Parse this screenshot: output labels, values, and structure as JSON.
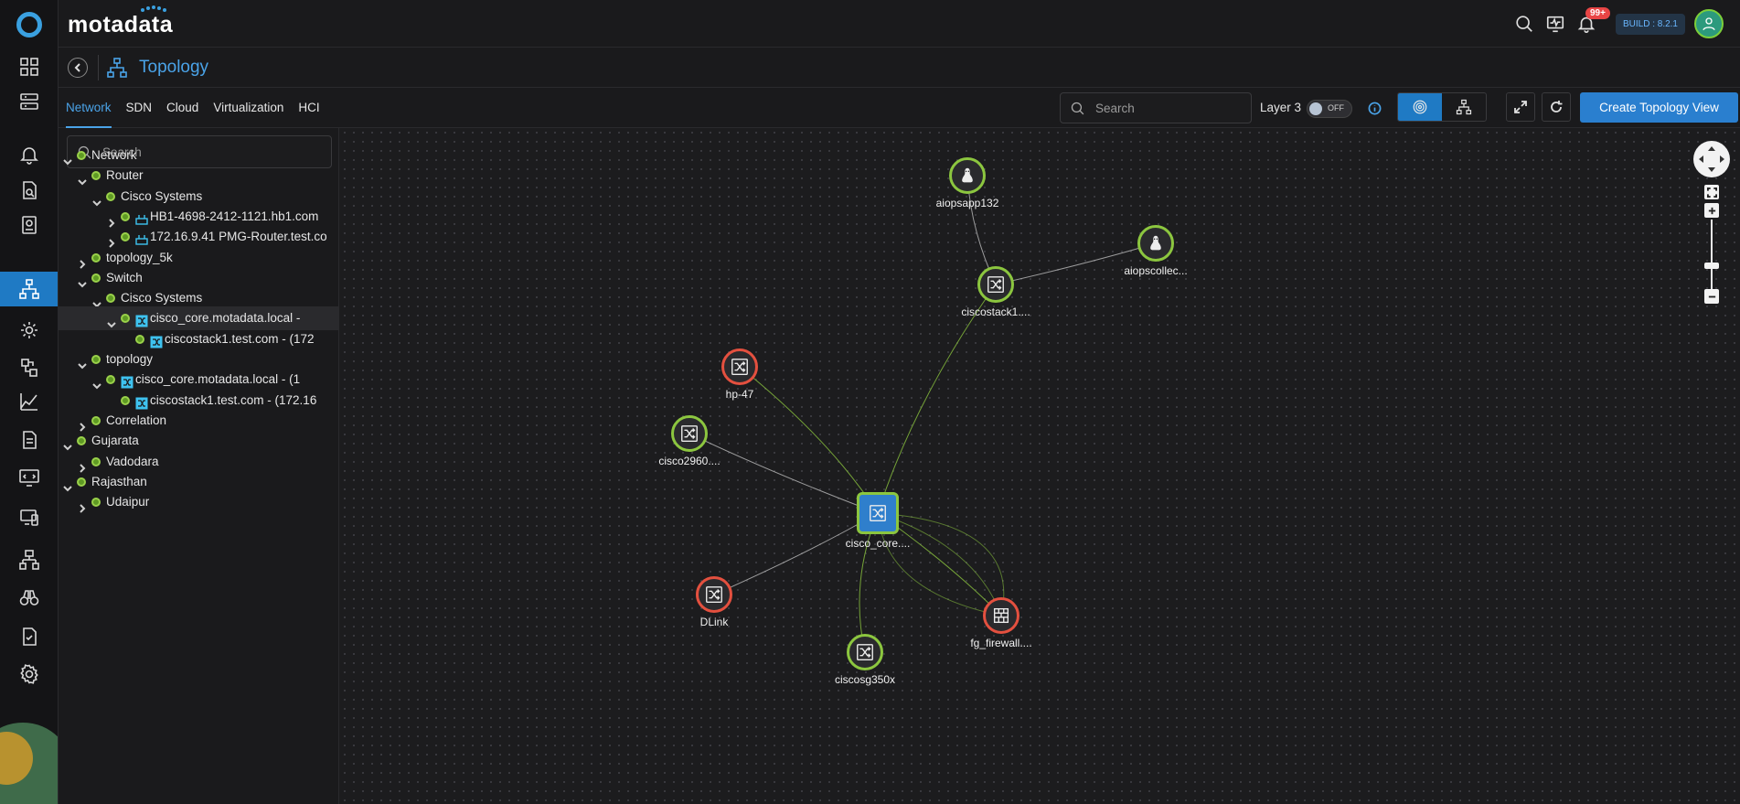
{
  "brand": {
    "name": "motadata"
  },
  "header": {
    "notification_count": "99+",
    "build": "BUILD : 8.2.1",
    "icons": [
      "search-icon",
      "monitor-icon",
      "bell-icon",
      "user-icon"
    ]
  },
  "rail": {
    "items": [
      "dashboard-icon",
      "server-icon",
      "alert-icon",
      "policy-icon",
      "inventory-icon",
      "topology-icon",
      "settings-cog-icon",
      "flow-icon",
      "metric-explorer-icon",
      "report-icon",
      "terminal-icon",
      "device-icon",
      "network-icon",
      "binoculars-icon",
      "audit-icon",
      "gear-icon"
    ],
    "active": "topology-icon"
  },
  "page": {
    "title": "Topology"
  },
  "tabs": [
    {
      "label": "Network",
      "active": true
    },
    {
      "label": "SDN",
      "active": false
    },
    {
      "label": "Cloud",
      "active": false
    },
    {
      "label": "Virtualization",
      "active": false
    },
    {
      "label": "HCI",
      "active": false
    }
  ],
  "toolbar": {
    "search_placeholder": "Search",
    "layer_label": "Layer 3",
    "layer_toggle": "OFF",
    "create_button": "Create Topology View"
  },
  "tree": {
    "search_placeholder": "Search",
    "rows": [
      {
        "label": "Network",
        "level": 0,
        "expanded": true,
        "icon": "none"
      },
      {
        "label": "Router",
        "level": 1,
        "expanded": true,
        "icon": "none"
      },
      {
        "label": "Cisco Systems",
        "level": 2,
        "expanded": true,
        "icon": "none"
      },
      {
        "label": "HB1-4698-2412-1121.hb1.com",
        "level": 3,
        "expanded": false,
        "icon": "router"
      },
      {
        "label": "172.16.9.41 PMG-Router.test.co",
        "level": 3,
        "expanded": false,
        "icon": "router"
      },
      {
        "label": "topology_5k",
        "level": 1,
        "expanded": false,
        "icon": "none"
      },
      {
        "label": "Switch",
        "level": 1,
        "expanded": true,
        "icon": "none"
      },
      {
        "label": "Cisco Systems",
        "level": 2,
        "expanded": true,
        "icon": "none"
      },
      {
        "label": "cisco_core.motadata.local -",
        "level": 3,
        "expanded": true,
        "icon": "switch",
        "selected": true
      },
      {
        "label": "ciscostack1.test.com - (172",
        "level": 4,
        "expanded": null,
        "icon": "switch"
      },
      {
        "label": "topology",
        "level": 1,
        "expanded": true,
        "icon": "none"
      },
      {
        "label": "cisco_core.motadata.local - (1",
        "level": 2,
        "expanded": true,
        "icon": "switch"
      },
      {
        "label": "ciscostack1.test.com - (172.16",
        "level": 3,
        "expanded": null,
        "icon": "switch"
      },
      {
        "label": "Correlation",
        "level": 1,
        "expanded": false,
        "icon": "none"
      },
      {
        "label": "Gujarata",
        "level": 0,
        "expanded": true,
        "icon": "none"
      },
      {
        "label": "Vadodara",
        "level": 1,
        "expanded": false,
        "icon": "none"
      },
      {
        "label": "Rajasthan",
        "level": 0,
        "expanded": true,
        "icon": "none"
      },
      {
        "label": "Udaipur",
        "level": 1,
        "expanded": false,
        "icon": "none"
      }
    ]
  },
  "topology": {
    "nodes": [
      {
        "id": "aiopsapp132",
        "label": "aiopsapp132",
        "type": "linux",
        "status": "green"
      },
      {
        "id": "aiopscollec",
        "label": "aiopscollec...",
        "type": "linux",
        "status": "green"
      },
      {
        "id": "ciscostack1",
        "label": "ciscostack1....",
        "type": "switch",
        "status": "green"
      },
      {
        "id": "hp47",
        "label": "hp-47",
        "type": "switch",
        "status": "red"
      },
      {
        "id": "cisco2960",
        "label": "cisco2960....",
        "type": "switch",
        "status": "green"
      },
      {
        "id": "cisco_core",
        "label": "cisco_core....",
        "type": "switch",
        "status": "core"
      },
      {
        "id": "dlink",
        "label": "DLink",
        "type": "switch",
        "status": "red"
      },
      {
        "id": "fg_firewall",
        "label": "fg_firewall....",
        "type": "firewall",
        "status": "red"
      },
      {
        "id": "ciscosg350x",
        "label": "ciscosg350x",
        "type": "switch",
        "status": "green"
      }
    ],
    "links": [
      {
        "from": "aiopsapp132",
        "to": "ciscostack1",
        "color": "#bdbdbd"
      },
      {
        "from": "aiopscollec",
        "to": "ciscostack1",
        "color": "#bdbdbd"
      },
      {
        "from": "ciscostack1",
        "to": "cisco_core",
        "color": "#8cc63f"
      },
      {
        "from": "hp47",
        "to": "cisco_core",
        "color": "#8cc63f"
      },
      {
        "from": "cisco2960",
        "to": "cisco_core",
        "color": "#bdbdbd"
      },
      {
        "from": "dlink",
        "to": "cisco_core",
        "color": "#bdbdbd"
      },
      {
        "from": "ciscosg350x",
        "to": "cisco_core",
        "color": "#8cc63f"
      },
      {
        "from": "fg_firewall",
        "to": "cisco_core",
        "color": "#8cc63f"
      }
    ]
  },
  "colors": {
    "accent": "#4aa3e8",
    "up": "#8cc63f",
    "down": "#e4503f",
    "primary": "#2a7fcf"
  }
}
